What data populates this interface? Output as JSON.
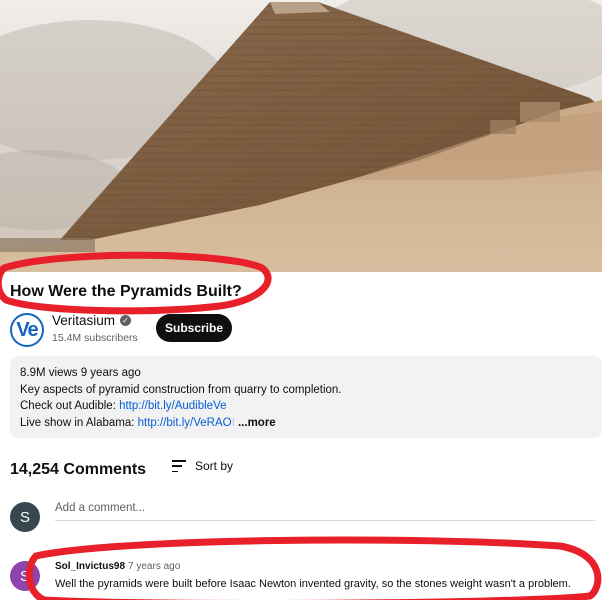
{
  "video": {
    "title": "How Were the Pyramids Built?"
  },
  "channel": {
    "logo_text": "Ve",
    "name": "Veritasium",
    "subscribers": "15.4M subscribers",
    "subscribe_label": "Subscribe"
  },
  "description": {
    "meta": "8.9M views  9 years ago",
    "line1": "Key aspects of pyramid construction from quarry to completion.",
    "line2_prefix": "Check out Audible: ",
    "line2_link": "http://bit.ly/AudibleVe",
    "line3_prefix": "Live show in Alabama: ",
    "line3_link": "http://bit.ly/VeRAO",
    "line3_fade": "I",
    "more_label": " ...more"
  },
  "comments": {
    "count": "14,254 Comments",
    "sort_label": "Sort by",
    "self_avatar": "S",
    "add_placeholder": "Add a comment...",
    "items": [
      {
        "avatar": "S",
        "author": "Sol_Invictus98",
        "time": "7 years ago",
        "text": "Well the pyramids were built before Isaac Newton invented gravity, so the stones weight wasn't a problem."
      }
    ]
  },
  "colors": {
    "annotation": "#e8202a",
    "link": "#065fd4",
    "subscribe_bg": "#0f0f0f",
    "logo": "#1565c0",
    "comment_avatar": "#8e44ad",
    "self_avatar": "#37474f"
  }
}
